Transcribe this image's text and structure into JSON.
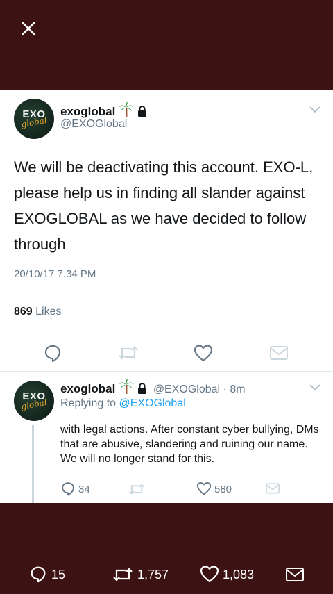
{
  "main_tweet": {
    "display_name": "exoglobal",
    "handle": "@EXOGlobal",
    "avatar_text": "EXO",
    "avatar_script": "global",
    "text": "We will be deactivating this account. EXO-L, please help us in finding all slander against EXOGLOBAL as we have decided to follow through",
    "timestamp": "20/10/17 7.34 PM",
    "likes_count": "869",
    "likes_label": "Likes"
  },
  "reply_tweet": {
    "display_name": "exoglobal",
    "handle": "@EXOGlobal",
    "time": "· 8m",
    "avatar_text": "EXO",
    "avatar_script": "global",
    "replying_prefix": "Replying to",
    "replying_to": "@EXOGlobal",
    "text": "with legal actions. After constant cyber bullying, DMs that are abusive, slandering and ruining our name. We will no longer stand for this.",
    "reply_count": "34",
    "like_count": "580"
  },
  "bottom_bar": {
    "replies": "15",
    "retweets": "1,757",
    "likes": "1,083"
  },
  "icons": {
    "close": "close-icon",
    "palm_tree": "palm-tree-icon",
    "lock": "lock-icon",
    "chevron": "chevron-down-icon",
    "reply": "reply-icon",
    "retweet": "retweet-icon",
    "like": "heart-icon",
    "dm": "envelope-icon"
  },
  "colors": {
    "overlay_bg": "#3d1212",
    "card_bg": "#ffffff",
    "text_primary": "#14171a",
    "text_secondary": "#657786",
    "link": "#1da1f2",
    "divider": "#e1e8ed"
  }
}
